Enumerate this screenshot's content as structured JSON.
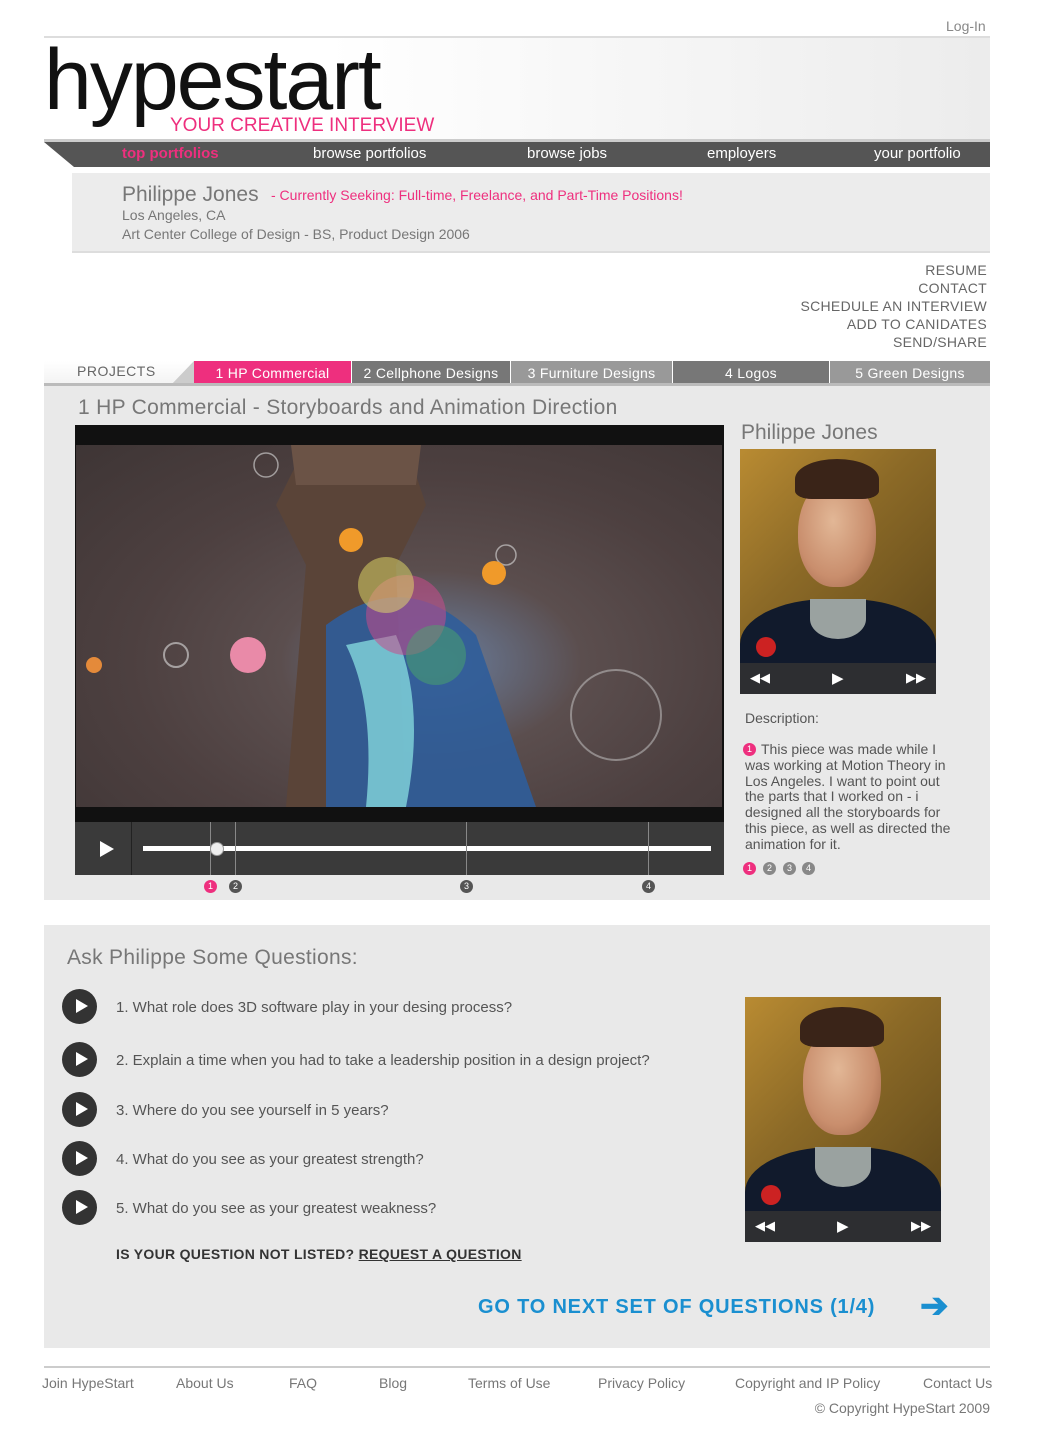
{
  "header": {
    "login": "Log-In",
    "logo": "hypestart",
    "tagline": "YOUR CREATIVE INTERVIEW"
  },
  "nav": {
    "items": [
      "top portfolios",
      "browse portfolios",
      "browse jobs",
      "employers",
      "your portfolio"
    ],
    "active": "top portfolios"
  },
  "profile": {
    "name": "Philippe Jones",
    "seeking": "- Currently Seeking: Full-time, Freelance, and Part-Time Positions!",
    "location": "Los Angeles, CA",
    "school": "Art Center College of Design - BS, Product Design 2006"
  },
  "side_links": [
    "RESUME",
    "CONTACT",
    "SCHEDULE AN INTERVIEW",
    "ADD TO CANIDATES",
    "SEND/SHARE"
  ],
  "projects": {
    "label": "PROJECTS",
    "tabs": [
      "1 HP Commercial",
      "2 Cellphone Designs",
      "3 Furniture Designs",
      "4 Logos",
      "5 Green Designs"
    ],
    "active_tab": "1 HP Commercial",
    "colors": {
      "active": "#ee2f7e",
      "tab2": "#777777",
      "tab3": "#999999",
      "tab4": "#777777",
      "tab5": "#999999"
    }
  },
  "project": {
    "title": "1 HP Commercial - Storyboards and Animation Direction",
    "markers": [
      "1",
      "2",
      "3",
      "4"
    ],
    "progress": 0.13
  },
  "side": {
    "name": "Philippe Jones",
    "controls": [
      "rewind-icon",
      "play-icon",
      "fast-forward-icon"
    ],
    "description_label": "Description:",
    "description_num": "1",
    "description": "This piece was made while I was working at Motion Theory in Los Angeles. I want to point out the parts that I worked on - i designed all the storyboards for this piece, as well as directed the animation for it.",
    "pages": [
      "1",
      "2",
      "3",
      "4"
    ]
  },
  "questions": {
    "title": "Ask Philippe Some Questions:",
    "items": [
      "1. What role does 3D software play in your desing process?",
      "2. Explain a time when you had to take a leadership position in a design project?",
      "3. Where do you see yourself in 5 years?",
      "4. What do you see as your greatest strength?",
      "5. What do you see as your greatest weakness?"
    ],
    "not_listed": "IS YOUR QUESTION NOT LISTED?",
    "request": "REQUEST A QUESTION",
    "next": "GO TO NEXT SET OF QUESTIONS (1/4)",
    "next_arrow": "➔"
  },
  "footer": {
    "links": [
      "Join HypeStart",
      "About Us",
      "FAQ",
      "Blog",
      "Terms of Use",
      "Privacy Policy",
      "Copyright and IP Policy",
      "Contact Us"
    ],
    "copyright": "©  Copyright HypeStart 2009"
  }
}
